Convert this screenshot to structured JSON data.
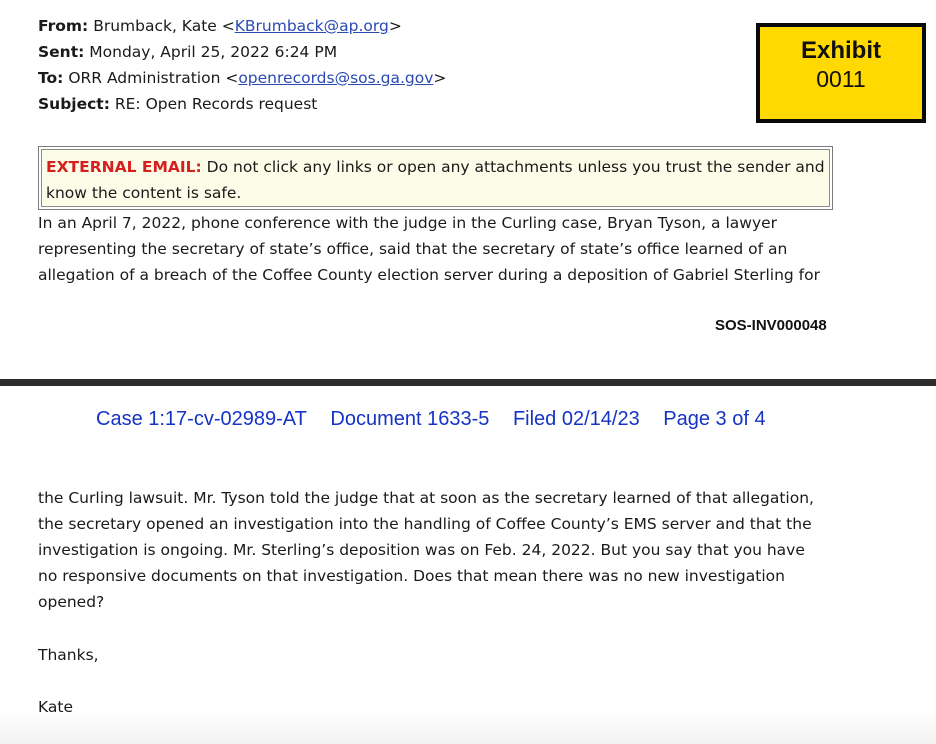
{
  "email": {
    "from_label": "From:",
    "from_value": "Brumback, Kate <",
    "from_email": "KBrumback@ap.org",
    "from_close": ">",
    "sent_label": "Sent:",
    "sent_value": "Monday, April 25, 2022 6:24 PM",
    "to_label": "To:",
    "to_value": "ORR Administration <",
    "to_email": "openrecords@sos.ga.gov",
    "to_close": ">",
    "subject_label": "Subject:",
    "subject_value": "RE: Open Records request"
  },
  "exhibit": {
    "title": "Exhibit",
    "number": "0011"
  },
  "warning": {
    "label": "EXTERNAL EMAIL:",
    "text": " Do not click any links or open any attachments unless you trust the sender and know the content is safe."
  },
  "body_page1": [
    "In an April 7, 2022, phone conference with the judge in the Curling case, Bryan Tyson, a lawyer",
    "representing the secretary of state’s office, said that the secretary of state’s office learned of an",
    "allegation of a breach of the Coffee County election server during a deposition of Gabriel Sterling for"
  ],
  "bates_number": "SOS-INV000048",
  "case_header": {
    "case": "Case 1:17-cv-02989-AT",
    "document": "Document 1633-5",
    "filed": "Filed 02/14/23",
    "page": "Page 3 of 4"
  },
  "body_page2": [
    "the Curling lawsuit. Mr. Tyson told the judge that at soon as the secretary learned of that allegation,",
    "the secretary opened an investigation into the handling of Coffee County’s EMS server and that the",
    "investigation is ongoing. Mr. Sterling’s deposition was on Feb. 24, 2022. But you say that you have",
    "no responsive documents on that investigation. Does that mean there was no new investigation",
    "opened?"
  ],
  "closing": {
    "thanks": "Thanks,",
    "signature": "Kate"
  }
}
